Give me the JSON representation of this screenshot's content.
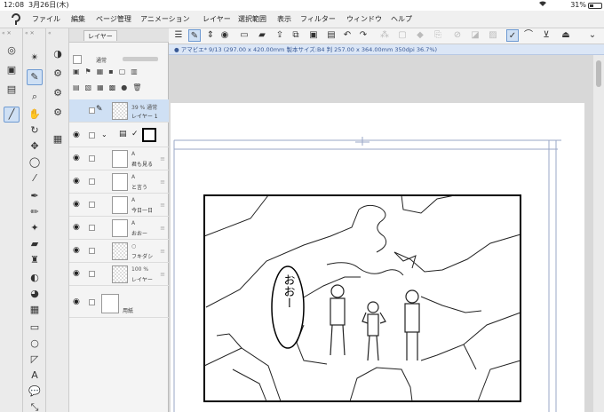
{
  "status": {
    "time": "12:08",
    "date": "3月26日(木)",
    "battery": "31%"
  },
  "menu": {
    "items": [
      "ファイル",
      "編集",
      "ページ管理",
      "アニメーション",
      "レイヤー",
      "選択範囲",
      "表示",
      "フィルター",
      "ウィンドウ",
      "ヘルプ"
    ]
  },
  "layers": {
    "tab_label": "レイヤー",
    "blend": "通常",
    "rows": [
      {
        "l1": "39 % 通常",
        "l2": "レイヤー 1",
        "selected": true
      },
      {
        "l1": "",
        "l2": "",
        "folder": true
      },
      {
        "l1": "",
        "l2": "君も見る"
      },
      {
        "l1": "",
        "l2": "と言う"
      },
      {
        "l1": "",
        "l2": "今日一日"
      },
      {
        "l1": "",
        "l2": "おおー"
      },
      {
        "l1": "",
        "l2": "フキダシ"
      },
      {
        "l1": "100 %",
        "l2": "レイヤー"
      },
      {
        "l1": "",
        "l2": "用紙",
        "paper": true
      }
    ]
  },
  "canvas": {
    "tab_title": "● アマビエ* 9/13 (297.00 x 420.00mm 製本サイズ:B4 判 257.00 x 364.00mm 350dpi 36.7%)"
  },
  "manga": {
    "speech": "おおー"
  }
}
